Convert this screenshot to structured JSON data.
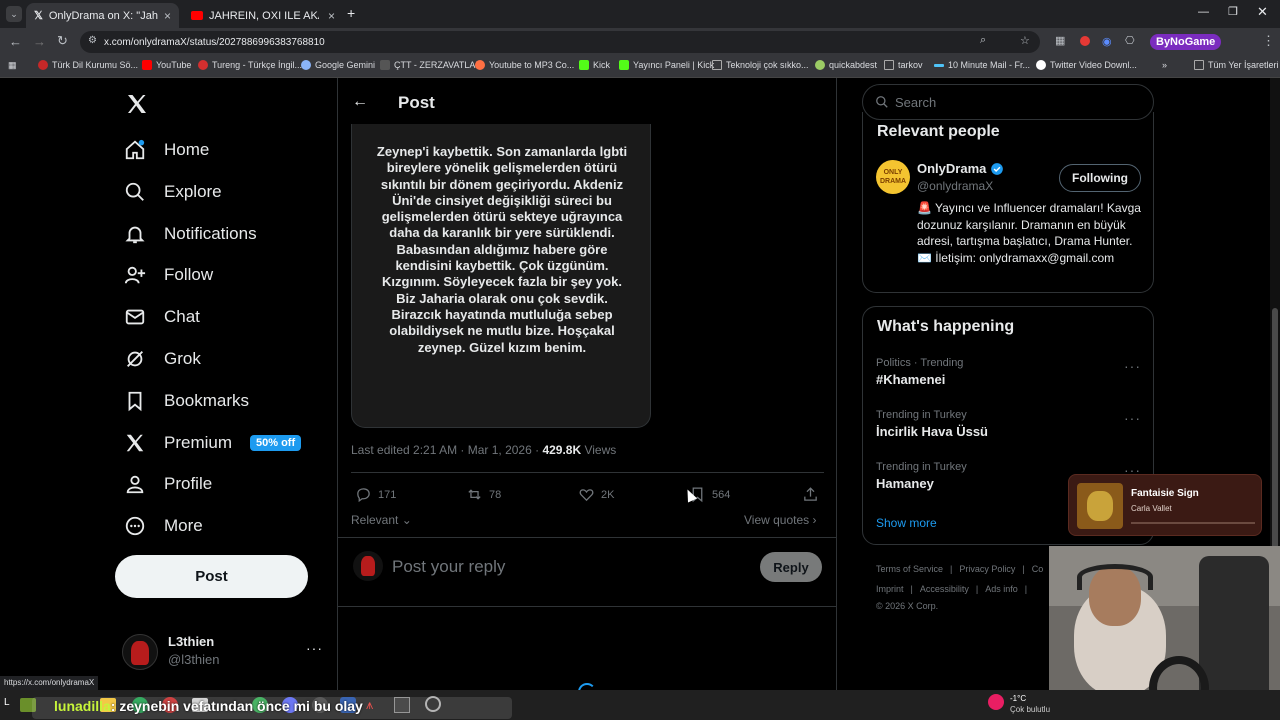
{
  "browser": {
    "tabs": [
      {
        "label": "OnlyDrama on X: \"Jahrein, tran"
      },
      {
        "label": "JAHREIN, OXI ILE AKAZEYNEP E"
      }
    ],
    "url": "x.com/onlydramaX/status/2027886996383768810",
    "profile_label": "ByNoGame",
    "bookmarks": [
      "Türk Dil Kurumu Sö...",
      "YouTube",
      "Tureng - Türkçe İngil...",
      "Google Gemini",
      "ÇTT - ZERZAVATLAR",
      "Youtube to MP3 Co...",
      "Kick",
      "Yayıncı Paneli | Kick",
      "Teknoloji çok sıkko...",
      "quickabdest",
      "tarkov",
      "10 Minute Mail - Fr...",
      "Twitter Video Downl..."
    ],
    "all_bookmarks": "Tüm Yer İşaretleri",
    "status_url": "https://x.com/onlydramaX"
  },
  "nav": {
    "items": [
      "Home",
      "Explore",
      "Notifications",
      "Follow",
      "Chat",
      "Grok",
      "Bookmarks",
      "Premium",
      "Profile",
      "More"
    ],
    "premium_badge": "50% off",
    "post_button": "Post",
    "account": {
      "name": "L3thien",
      "handle": "@l3thien"
    }
  },
  "header": {
    "title": "Post"
  },
  "post": {
    "image_text": "Zeynep'i kaybettik. Son zamanlarda lgbti bireylere yönelik gelişmelerden ötürü sıkıntılı bir dönem geçiriyordu. Akdeniz Üni'de cinsiyet değişikliği süreci bu gelişmelerden ötürü sekteye uğrayınca daha da karanlık bir yere sürüklendi. Babasından aldığımız habere göre kendisini kaybettik. Çok üzgünüm. Kızgınım. Söyleyecek fazla bir şey yok. Biz Jaharia olarak onu çok sevdik. Birazcık hayatında mutluluğa sebep olabildiysek ne mutlu bize. Hoşçakal zeynep. Güzel kızım benim.",
    "meta_prefix": "Last edited 2:21 AM · Mar 1, 2026 · ",
    "views_count": "429.8K",
    "views_label": " Views",
    "replies": "171",
    "reposts": "78",
    "likes": "2K",
    "bookmarks": "564",
    "relevant": "Relevant",
    "view_quotes": "View quotes",
    "reply_placeholder": "Post your reply",
    "reply_button": "Reply"
  },
  "search": {
    "placeholder": "Search"
  },
  "relevant_people": {
    "title": "Relevant people",
    "name": "OnlyDrama",
    "handle": "@onlydramaX",
    "follow_label": "Following",
    "bio": "🚨 Yayıncı ve Influencer dramaları! Kavga dozunuz karşılanır. Dramanın en büyük adresi, tartışma başlatıcı, Drama Hunter. ✉️ İletişim: onlydramaxx@gmail.com"
  },
  "happening": {
    "title": "What's happening",
    "trends": [
      {
        "context": "Politics · Trending",
        "title": "#Khamenei"
      },
      {
        "context": "Trending in Turkey",
        "title": "İncirlik Hava Üssü"
      },
      {
        "context": "Trending in Turkey",
        "title": "Hamaney"
      }
    ],
    "show_more": "Show more"
  },
  "footer": {
    "row1": [
      "Terms of Service",
      "Privacy Policy",
      "Co"
    ],
    "row2": [
      "Imprint",
      "Accessibility",
      "Ads info"
    ],
    "copyright": "© 2026 X Corp."
  },
  "overlay": {
    "music_title": "Fantaisie Sign",
    "music_artist": "Carla Vallet",
    "chat_user": "lunadilla",
    "chat_message": ": zeynebin vefatından önce mi bu olay",
    "weather_temp": "-1°C",
    "weather_text": "Çok bulutlu"
  }
}
